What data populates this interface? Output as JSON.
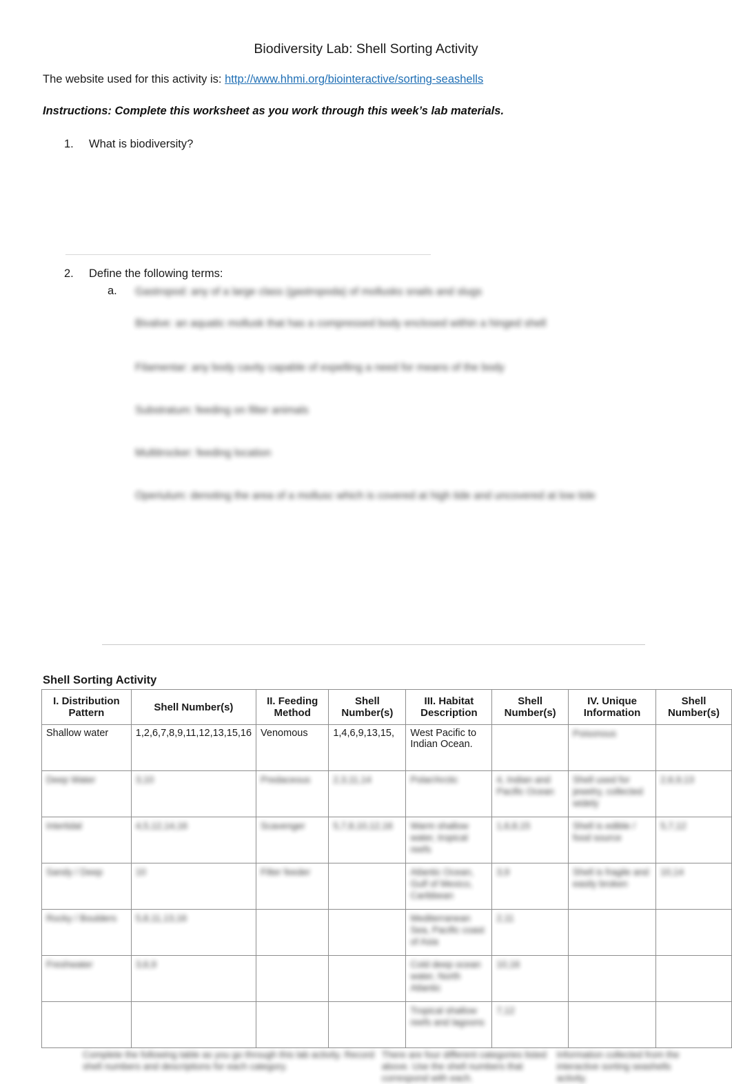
{
  "document": {
    "title": "Biodiversity Lab: Shell Sorting Activity",
    "website_prefix": "The website used for this activity is: ",
    "website_url": "http://www.hhmi.org/biointeractive/sorting-seashells",
    "instructions": "Instructions: Complete this worksheet as you work through this week’s lab materials.",
    "question1_number": "1.",
    "question1_text": "What is biodiversity?",
    "question2_number": "2.",
    "question2_text": "Define the following terms:",
    "sub_a_marker": "a.",
    "definitions": [
      "Gastropod: any of a large class (gastropoda) of mollusks snails and slugs",
      "Bivalve: an aquatic mollusk that has a compressed body enclosed within a hinged shell",
      "Filamentar: any body cavity capable of expelling a need for means of the body",
      "Substratum: feeding on filter animals",
      "Multitrocker: feeding location",
      "Operiulum: denoting the area of a mollusc which is covered at high tide and uncovered at low tide"
    ],
    "section_title": "Shell Sorting Activity"
  },
  "table": {
    "headers": [
      "I.  Distribution Pattern",
      "Shell Number(s)",
      "II. Feeding Method",
      "Shell Number(s)",
      "III. Habitat Description",
      "Shell Number(s)",
      "IV. Unique Information",
      "Shell Number(s)"
    ],
    "rows": [
      {
        "blurred": false,
        "cells": [
          "Shallow water",
          "1,2,6,7,8,9,11,12,13,15,16",
          "Venomous",
          "1,4,6,9,13,15,",
          "West Pacific to Indian Ocean.",
          "",
          "Poisonous",
          ""
        ]
      },
      {
        "blurred": true,
        "cells": [
          "Deep Water",
          "3,10",
          "Predaceous",
          "2,3,11,14",
          "Polar/Arctic",
          "4, Indian and Pacific Ocean",
          "Shell used for jewelry, collected widely",
          "2,6,9,13"
        ]
      },
      {
        "blurred": true,
        "cells": [
          "Intertidal",
          "4,5,12,14,16",
          "Scavenger",
          "5,7,8,10,12,16",
          "Warm shallow water, tropical reefs",
          "1,6,8,15",
          "Shell is edible / food source",
          "5,7,12"
        ]
      },
      {
        "blurred": true,
        "cells": [
          "Sandy / Deep",
          "10",
          "Filter feeder",
          "",
          "Atlantic Ocean, Gulf of Mexico, Caribbean",
          "3,9",
          "Shell is fragile and easily broken",
          "10,14"
        ]
      },
      {
        "blurred": true,
        "cells": [
          "Rocky / Boulders",
          "5,8,11,13,16",
          "",
          "",
          "Mediterranean Sea, Pacific coast of Asia",
          "2,11",
          "",
          ""
        ]
      },
      {
        "blurred": true,
        "cells": [
          "Freshwater",
          "3,6,9",
          "",
          "",
          "Cold deep ocean water, North Atlantic",
          "10,16",
          "",
          ""
        ]
      },
      {
        "blurred": true,
        "cells": [
          "",
          "",
          "",
          "",
          "Tropical shallow reefs and lagoons",
          "7,12",
          "",
          ""
        ]
      }
    ]
  },
  "footer": {
    "left": "Complete the following table as you go through this lab activity. Record shell numbers and descriptions for each category.",
    "middle": "There are four different categories listed above. Use the shell numbers that correspond with each.",
    "right": "Information collected from the interactive sorting seashells activity."
  }
}
